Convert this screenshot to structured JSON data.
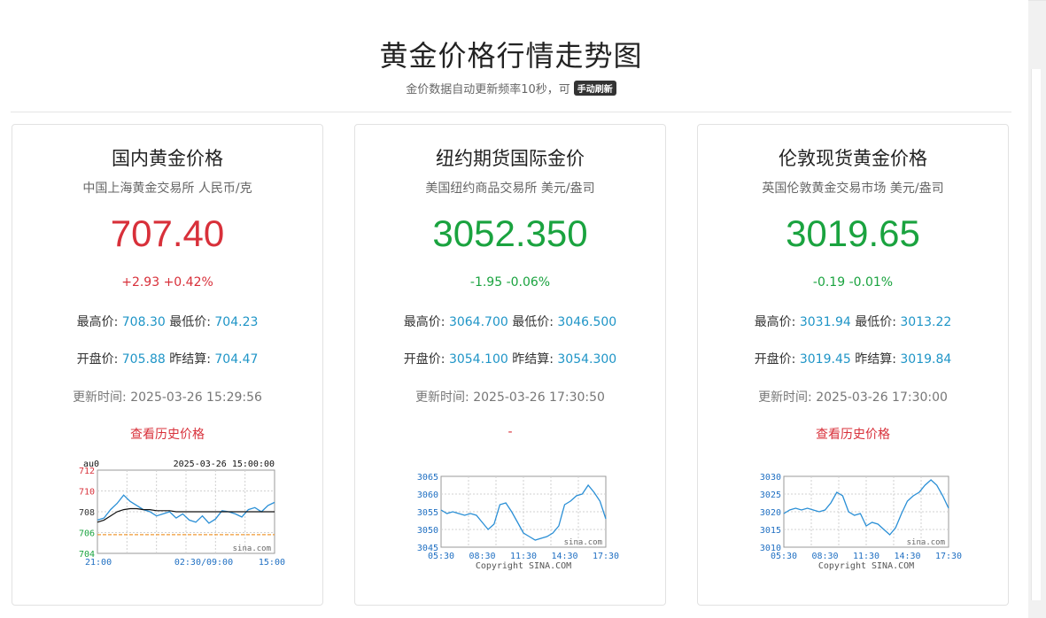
{
  "header": {
    "title": "黄金价格行情走势图",
    "subtitle": "金价数据自动更新频率10秒，可",
    "refresh_label": "手动刷新"
  },
  "labels": {
    "high": "最高价:",
    "low": "最低价:",
    "open": "开盘价:",
    "prev_settle": "昨结算:",
    "update": "更新时间:"
  },
  "cards": [
    {
      "title": "国内黄金价格",
      "subtitle": "中国上海黄金交易所 人民币/克",
      "price": "707.40",
      "change": "+2.93 +0.42%",
      "trend": "up",
      "high": "708.30",
      "low": "704.23",
      "open": "705.88",
      "prev_settle": "704.47",
      "update_time": "2025-03-26 15:29:56",
      "link": "查看历史价格"
    },
    {
      "title": "纽约期货国际金价",
      "subtitle": "美国纽约商品交易所 美元/盎司",
      "price": "3052.350",
      "change": "-1.95 -0.06%",
      "trend": "down",
      "high": "3064.700",
      "low": "3046.500",
      "open": "3054.100",
      "prev_settle": "3054.300",
      "update_time": "2025-03-26 17:30:50",
      "link": "-"
    },
    {
      "title": "伦敦现货黄金价格",
      "subtitle": "英国伦敦黄金交易市场 美元/盎司",
      "price": "3019.65",
      "change": "-0.19 -0.01%",
      "trend": "down",
      "high": "3031.94",
      "low": "3013.22",
      "open": "3019.45",
      "prev_settle": "3019.84",
      "update_time": "2025-03-26 17:30:00",
      "link": "查看历史价格"
    }
  ],
  "chart_data": [
    {
      "type": "line",
      "header_left": "au0",
      "header_right": "2025-03-26 15:00:00",
      "y_ticks": [
        "712",
        "710",
        "708",
        "706",
        "704"
      ],
      "x_ticks": [
        "21:00",
        "02:30/09:00",
        "15:00"
      ],
      "watermark": "sina.com",
      "ylim": [
        704,
        712
      ],
      "reference_line": 705.8,
      "series": [
        {
          "values": [
            707.2,
            707.4,
            708.2,
            708.8,
            709.6,
            709.0,
            708.6,
            708.2,
            708.0,
            707.6,
            707.8,
            708.0,
            707.4,
            707.8,
            707.2,
            707.0,
            707.6,
            706.9,
            707.3,
            708.1,
            708.0,
            707.8,
            707.5,
            708.2,
            708.4,
            708.0,
            708.6,
            708.9
          ]
        },
        {
          "values": [
            707.0,
            707.2,
            707.6,
            708.0,
            708.2,
            708.3,
            708.3,
            708.2,
            708.2,
            708.1,
            708.1,
            708.1,
            708.0,
            708.0,
            708.0,
            708.0,
            708.0,
            708.0,
            708.0,
            708.0,
            708.0,
            708.0,
            708.0,
            708.0,
            708.0,
            708.0,
            708.0,
            708.0
          ]
        }
      ]
    },
    {
      "type": "line",
      "y_ticks": [
        "3065",
        "3060",
        "3055",
        "3050",
        "3045"
      ],
      "x_ticks": [
        "05:30",
        "08:30",
        "11:30",
        "14:30",
        "17:30"
      ],
      "watermark": "sina.com",
      "copyright": "Copyright  SINA.COM",
      "ylim": [
        3045,
        3065
      ],
      "series": [
        {
          "values": [
            3055.5,
            3054.5,
            3055.0,
            3054.5,
            3054.0,
            3054.5,
            3054.0,
            3052.0,
            3050.0,
            3051.5,
            3057.0,
            3057.5,
            3055.0,
            3052.0,
            3049.0,
            3048.0,
            3047.0,
            3047.5,
            3048.0,
            3049.0,
            3051.0,
            3057.0,
            3058.0,
            3059.5,
            3060.0,
            3062.5,
            3060.5,
            3058.0,
            3053.0
          ]
        }
      ]
    },
    {
      "type": "line",
      "y_ticks": [
        "3030",
        "3025",
        "3020",
        "3015",
        "3010"
      ],
      "x_ticks": [
        "05:30",
        "08:30",
        "11:30",
        "14:30",
        "17:30"
      ],
      "watermark": "sina.com",
      "copyright": "Copyright  SINA.COM",
      "ylim": [
        3010,
        3030
      ],
      "series": [
        {
          "values": [
            3019.5,
            3020.5,
            3021.0,
            3020.5,
            3021.0,
            3020.5,
            3020.0,
            3020.5,
            3022.5,
            3025.5,
            3024.5,
            3020.0,
            3019.0,
            3019.5,
            3016.0,
            3017.0,
            3016.5,
            3015.0,
            3013.5,
            3015.5,
            3019.5,
            3023.0,
            3024.5,
            3025.5,
            3027.5,
            3029.0,
            3027.5,
            3024.5,
            3021.0
          ]
        }
      ]
    }
  ],
  "colors": {
    "up": "#d8303a",
    "down": "#1aa33f",
    "value": "#1f95c7",
    "chart_line": "#2a8fd6",
    "avg_line": "#111111",
    "reference": "#f09a33",
    "axis_text": "#1f6fc2"
  }
}
